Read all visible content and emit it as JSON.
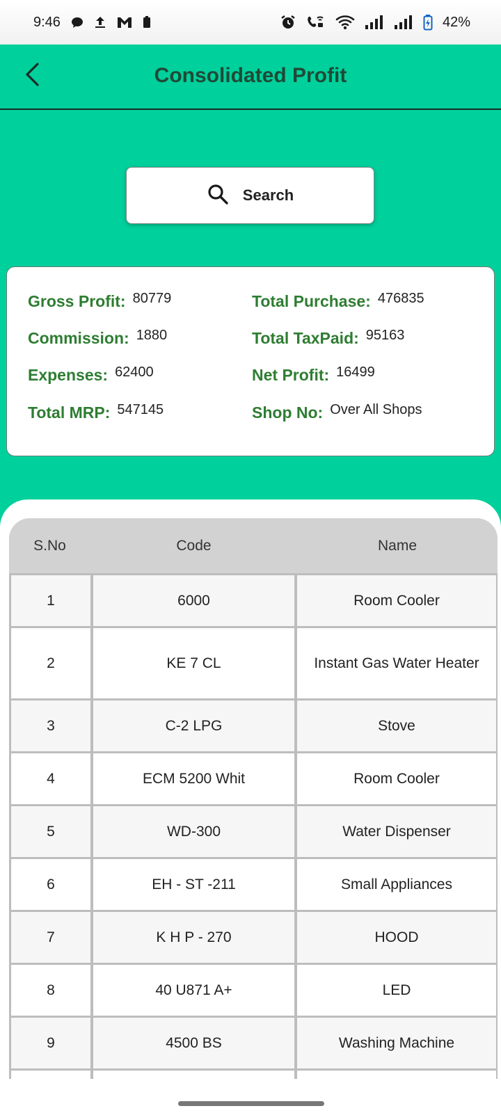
{
  "status_bar": {
    "time": "9:46",
    "battery": "42%",
    "icons": [
      "message-icon",
      "upload-icon",
      "gmail-icon",
      "battery-small-icon",
      "alarm-icon",
      "wifi-call-icon",
      "wifi-icon",
      "signal-icon",
      "signal-icon",
      "battery-icon"
    ]
  },
  "header": {
    "title": "Consolidated Profit",
    "back_icon": "back-arrow-icon"
  },
  "search": {
    "label": "Search",
    "icon": "search-icon"
  },
  "summary": {
    "gross_profit": {
      "label": "Gross Profit:",
      "value": "80779"
    },
    "total_purchase": {
      "label": "Total Purchase:",
      "value": "476835"
    },
    "commission": {
      "label": "Commission:",
      "value": "1880"
    },
    "total_taxpaid": {
      "label": "Total TaxPaid:",
      "value": "95163"
    },
    "expenses": {
      "label": "Expenses:",
      "value": "62400"
    },
    "net_profit": {
      "label": "Net Profit:",
      "value": "16499"
    },
    "total_mrp": {
      "label": "Total MRP:",
      "value": "547145"
    },
    "shop_no": {
      "label": "Shop No:",
      "value": "Over All Shops"
    }
  },
  "table": {
    "columns": [
      "S.No",
      "Code",
      "Name"
    ],
    "rows": [
      {
        "sno": "1",
        "code": "6000",
        "name": "Room Cooler"
      },
      {
        "sno": "2",
        "code": "KE 7 CL",
        "name": "Instant Gas Water Heater"
      },
      {
        "sno": "3",
        "code": "C-2 LPG",
        "name": "Stove"
      },
      {
        "sno": "4",
        "code": "ECM 5200 Whit",
        "name": "Room Cooler"
      },
      {
        "sno": "5",
        "code": "WD-300",
        "name": "Water Dispenser"
      },
      {
        "sno": "6",
        "code": "EH - ST -211",
        "name": "Small Appliances"
      },
      {
        "sno": "7",
        "code": "K H P - 270",
        "name": "HOOD"
      },
      {
        "sno": "8",
        "code": "40 U871 A+",
        "name": "LED"
      },
      {
        "sno": "9",
        "code": "4500 BS",
        "name": "Washing Machine"
      }
    ]
  },
  "colors": {
    "accent": "#00d09c",
    "label_green": "#2e7d32",
    "title_dark": "#1f4a37"
  }
}
